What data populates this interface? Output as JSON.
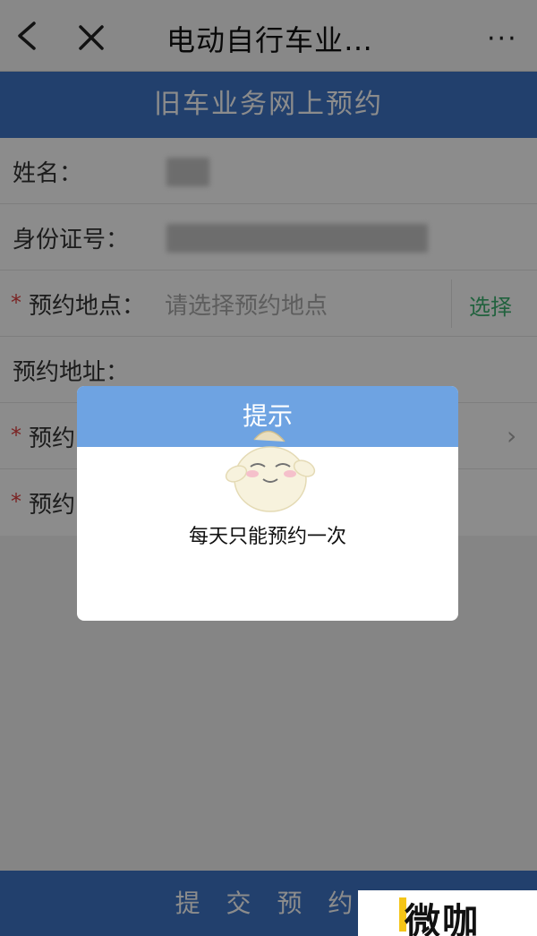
{
  "topbar": {
    "title": "电动自行车业…",
    "more": "···"
  },
  "header": {
    "title": "旧车业务网上预约"
  },
  "form": {
    "rows": [
      {
        "label": "姓名：",
        "required": false
      },
      {
        "label": "身份证号：",
        "required": false
      },
      {
        "label": "预约地点：",
        "required": true,
        "placeholder": "请选择预约地点",
        "action": "选择"
      },
      {
        "label": "预约地址：",
        "required": false
      },
      {
        "label": "预约",
        "required": true
      },
      {
        "label": "预约",
        "required": true
      }
    ],
    "required_mark": "*"
  },
  "dialog": {
    "title": "提示",
    "message": "每天只能预约一次"
  },
  "submit": {
    "label": "提 交 预 约"
  },
  "watermark": {
    "text": "微咖"
  },
  "colors": {
    "primary": "#3f76c6",
    "dialog_header": "#6ea3e2",
    "select_action": "#3cb371",
    "required": "#e04040"
  }
}
